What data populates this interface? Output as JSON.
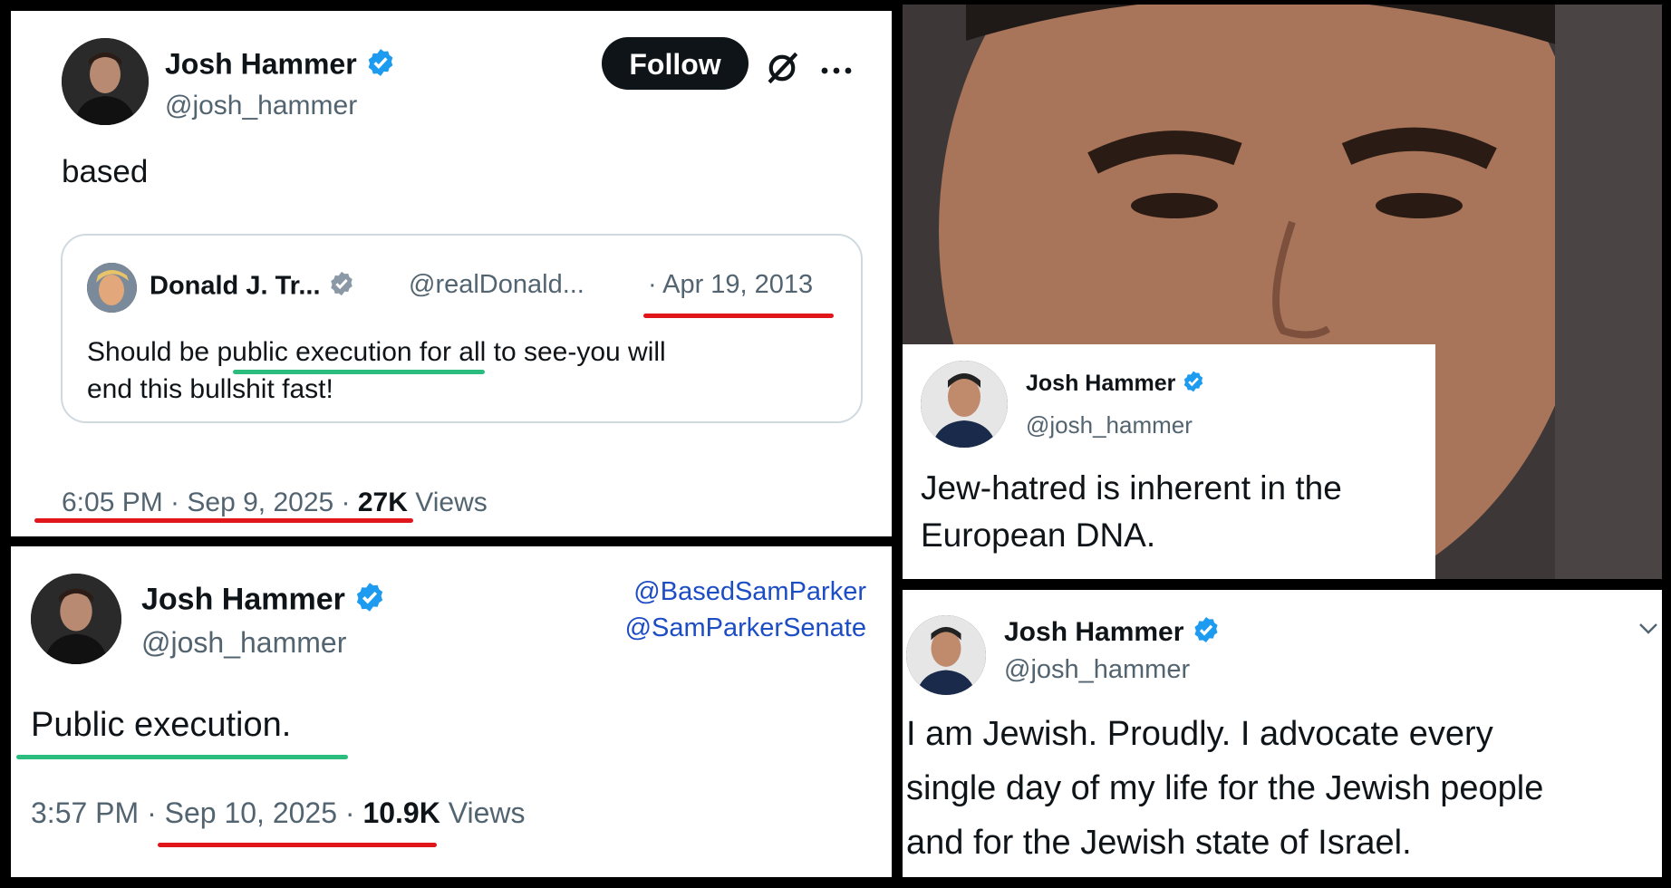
{
  "tweet1": {
    "name": "Josh Hammer",
    "handle": "@josh_hammer",
    "follow_label": "Follow",
    "text": "based",
    "quote": {
      "name": "Donald J. Tr...",
      "handle": "@realDonald...",
      "date": "· Apr 19, 2013",
      "line1": "Should be public execution for all to see-you will",
      "line2": "end this bullshit fast!"
    },
    "time_date": "6:05 PM · Sep 9, 2025 ·",
    "views_count": "27K",
    "views_label": "Views"
  },
  "tweet2": {
    "name": "Josh Hammer",
    "handle": "@josh_hammer",
    "mention1": "@BasedSamParker",
    "mention2": "@SamParkerSenate",
    "text": "Public execution.",
    "time_date": "3:57 PM · Sep 10, 2025 ·",
    "views_count": "10.9K",
    "views_label": "Views"
  },
  "tweet3": {
    "name": "Josh Hammer",
    "handle": "@josh_hammer",
    "line1": "Jew-hatred is inherent in the",
    "line2": "European DNA."
  },
  "tweet4": {
    "name": "Josh Hammer",
    "handle": "@josh_hammer",
    "line1": "I am Jewish. Proudly. I advocate every",
    "line2": "single day of my life for the Jewish people",
    "line3": "and for the Jewish state of Israel."
  },
  "colors": {
    "verified_blue": "#1d9bf0",
    "underline_red": "#e0161a",
    "underline_green": "#2bbd7e",
    "mention_blue": "#1d4dc4"
  },
  "icons": [
    "verified-badge-icon",
    "grok-icon",
    "more-icon",
    "chevron-down-icon"
  ]
}
